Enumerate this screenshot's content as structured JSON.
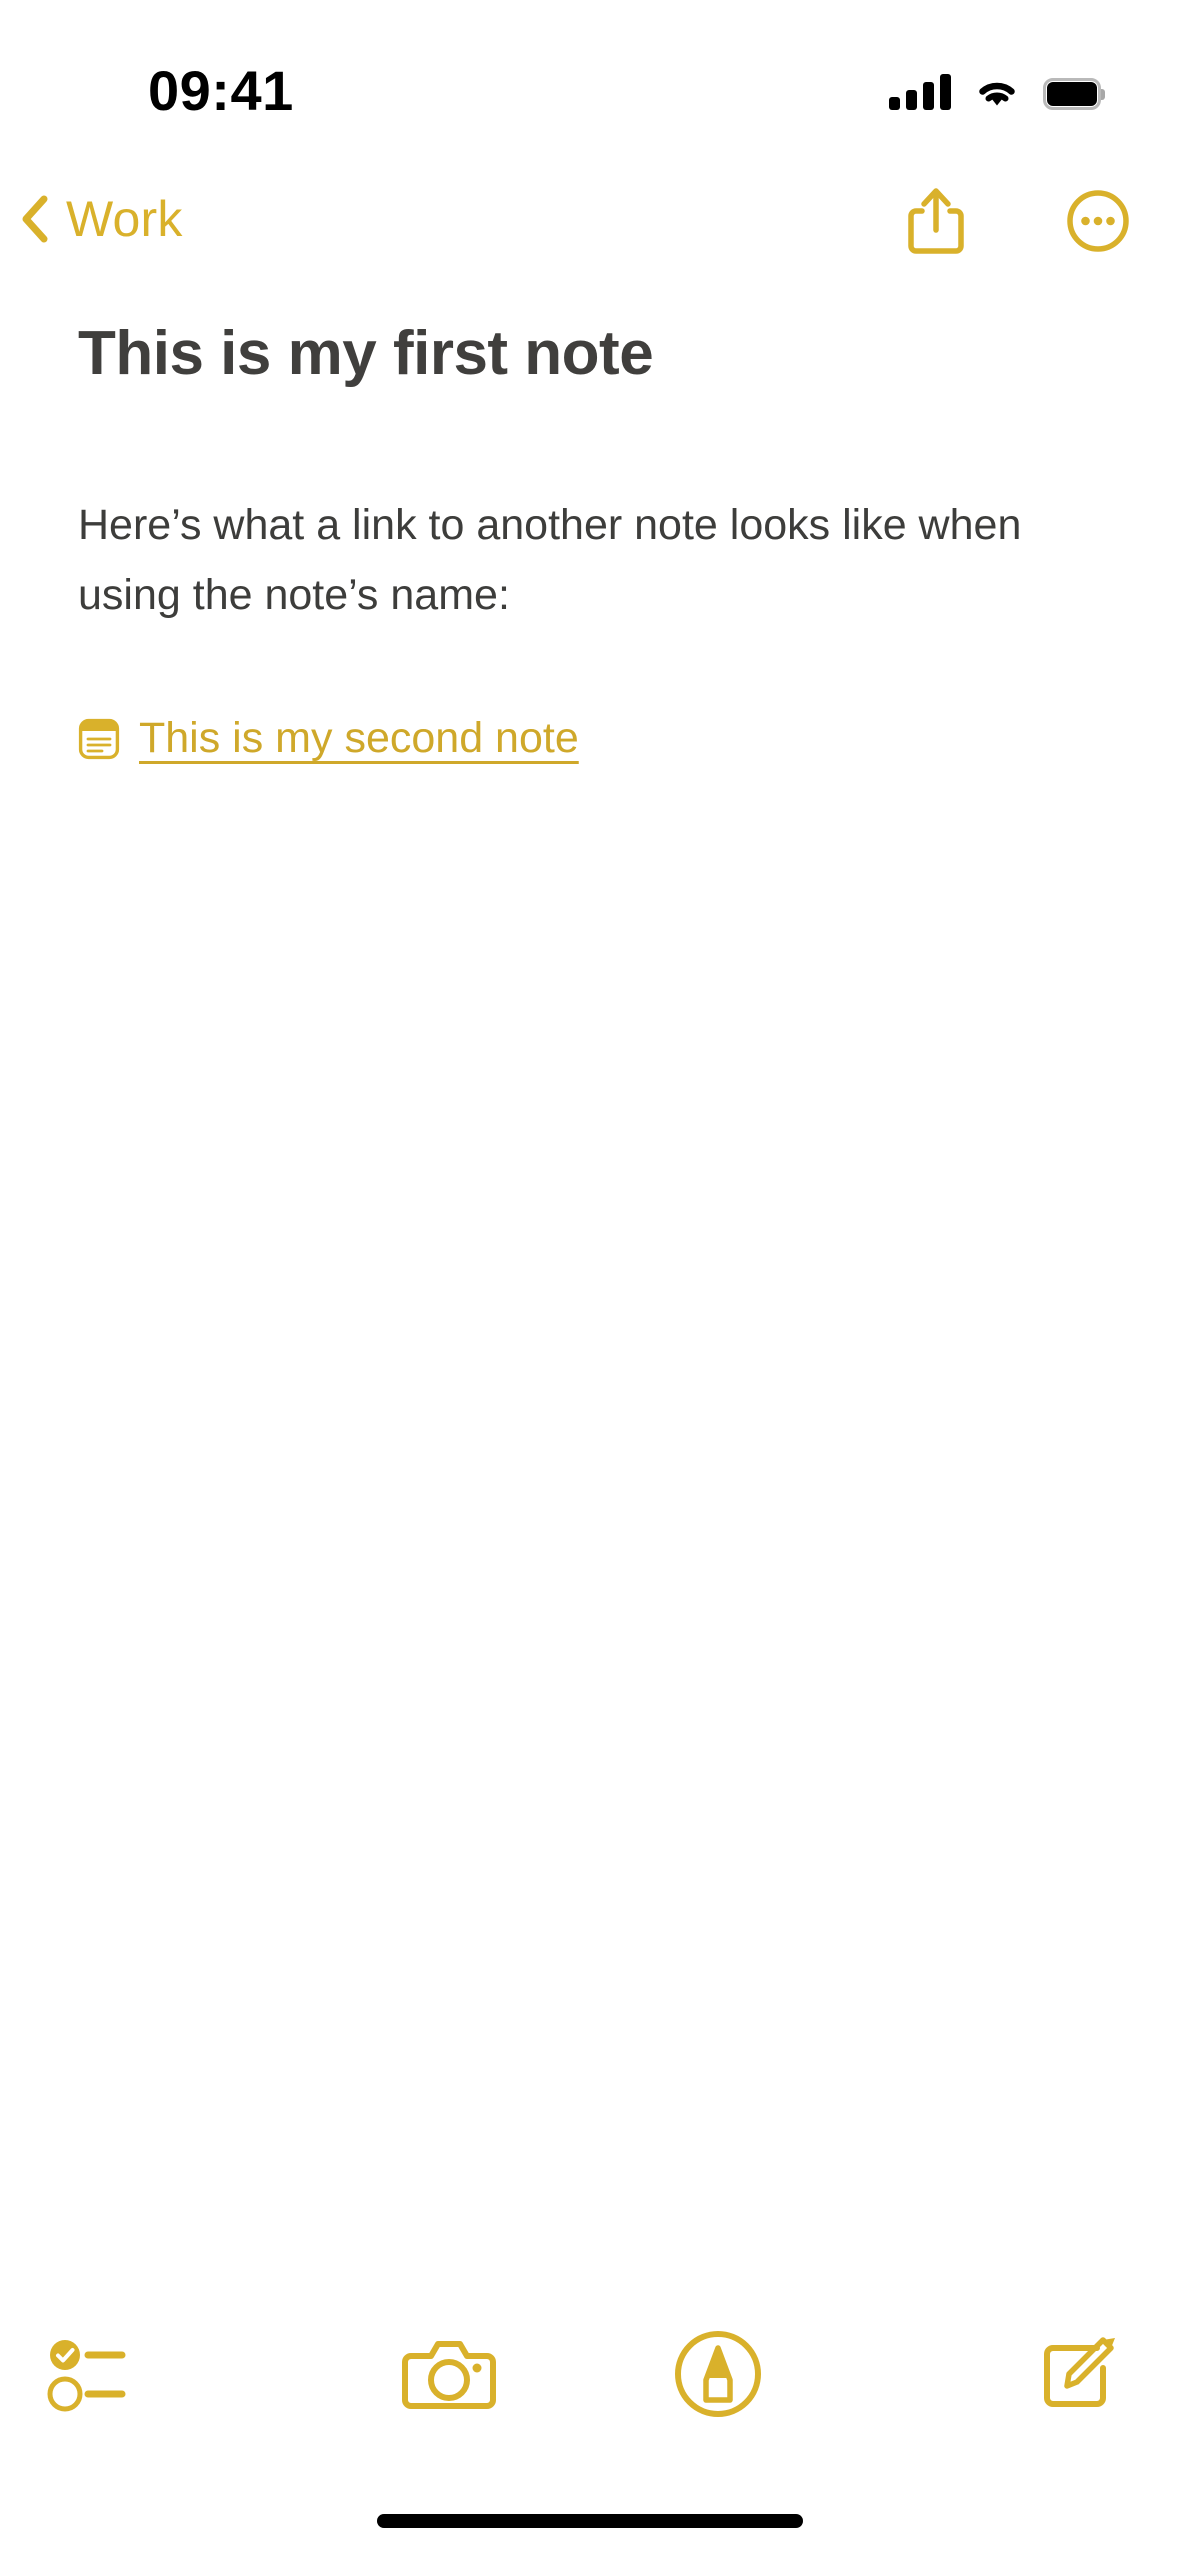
{
  "status_bar": {
    "time": "09:41",
    "cellular_icon": "cellular-signal-icon",
    "wifi_icon": "wifi-icon",
    "battery_icon": "battery-full-icon"
  },
  "nav_bar": {
    "back_label": "Work",
    "back_chevron_icon": "chevron-left-icon",
    "share_icon": "share-icon",
    "more_icon": "ellipsis-circle-icon"
  },
  "note": {
    "title": "This is my first note",
    "paragraph": "Here’s what a link to another note looks like when using the note’s name:",
    "link": {
      "icon": "note-document-icon",
      "label": "This is my second note"
    }
  },
  "toolbar": {
    "items": [
      {
        "name": "checklist-icon",
        "label": "Checklist"
      },
      {
        "name": "camera-icon",
        "label": "Camera"
      },
      {
        "name": "markup-pen-icon",
        "label": "Markup"
      },
      {
        "name": "compose-icon",
        "label": "Compose"
      }
    ]
  },
  "colors": {
    "accent": "#D9B12B",
    "link": "#CFA82A",
    "title_text": "#403F3D",
    "body_text": "#3D3D3B",
    "background": "#FFFFFF"
  }
}
